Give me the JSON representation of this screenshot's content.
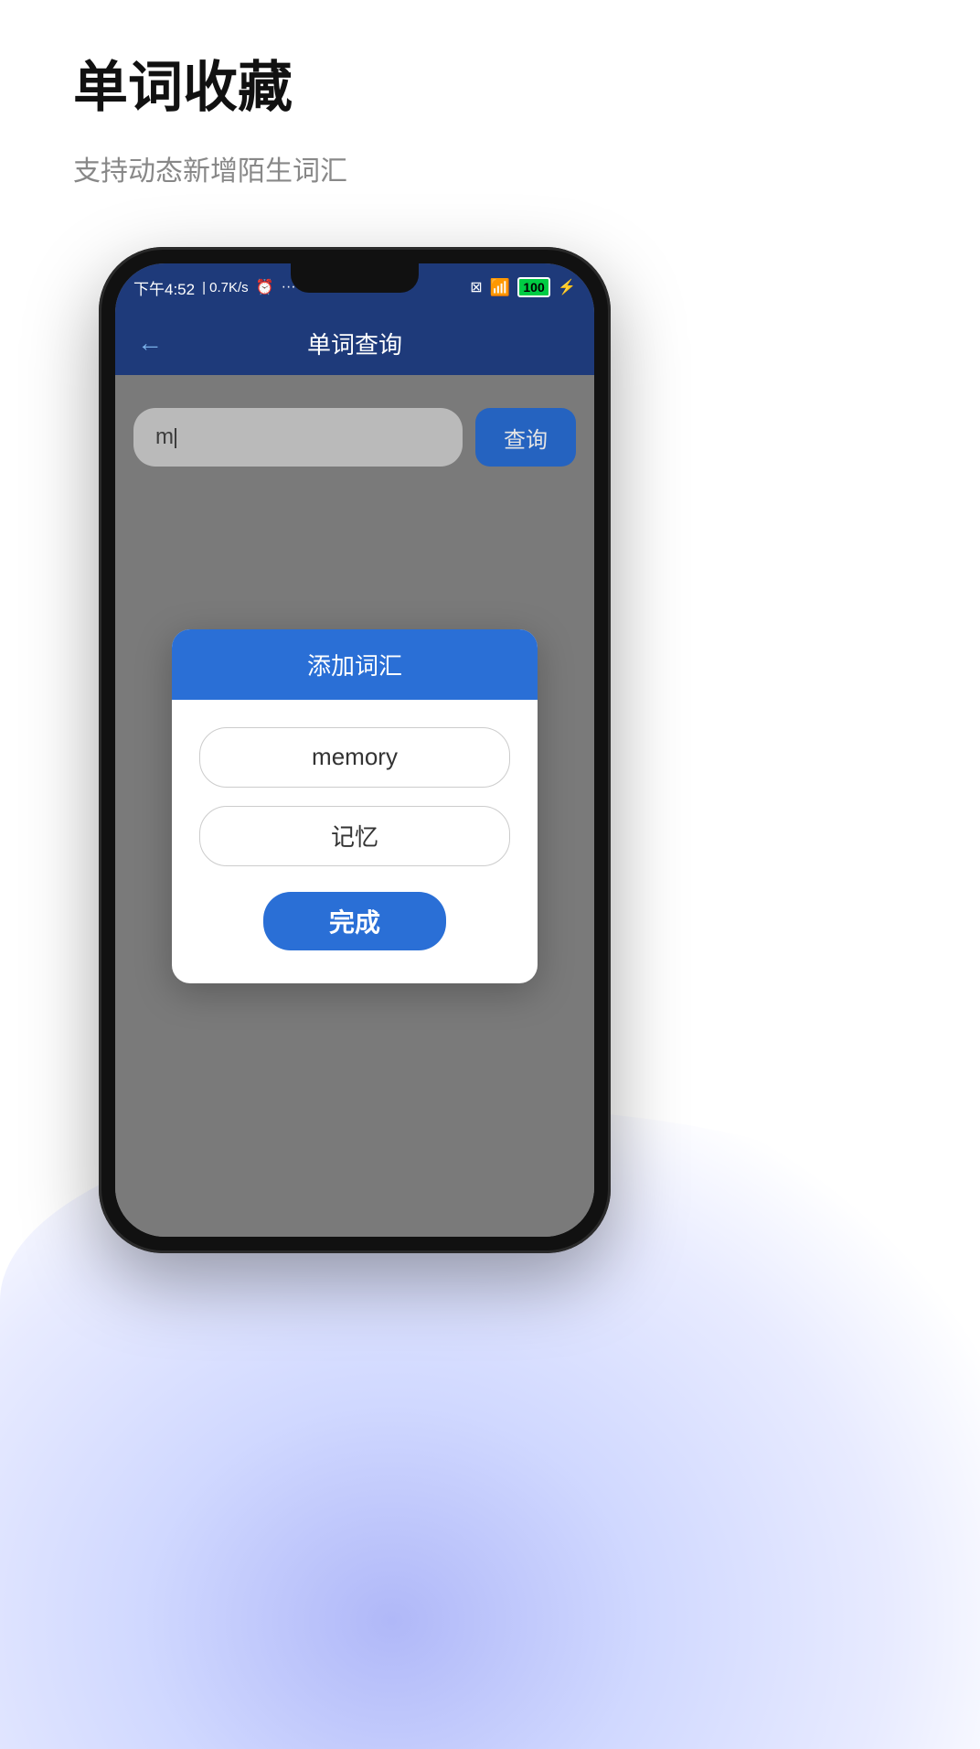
{
  "page": {
    "title": "单词收藏",
    "subtitle": "支持动态新增陌生词汇"
  },
  "status_bar": {
    "time": "下午4:52",
    "network": "0.7K/s",
    "battery": "100",
    "battery_label": "100"
  },
  "nav": {
    "back_icon": "←",
    "title": "单词查询"
  },
  "search": {
    "input_value": "m",
    "button_label": "查询"
  },
  "dialog": {
    "title": "添加词汇",
    "word_field": "memory",
    "translation_field": "记忆",
    "done_button": "完成"
  }
}
